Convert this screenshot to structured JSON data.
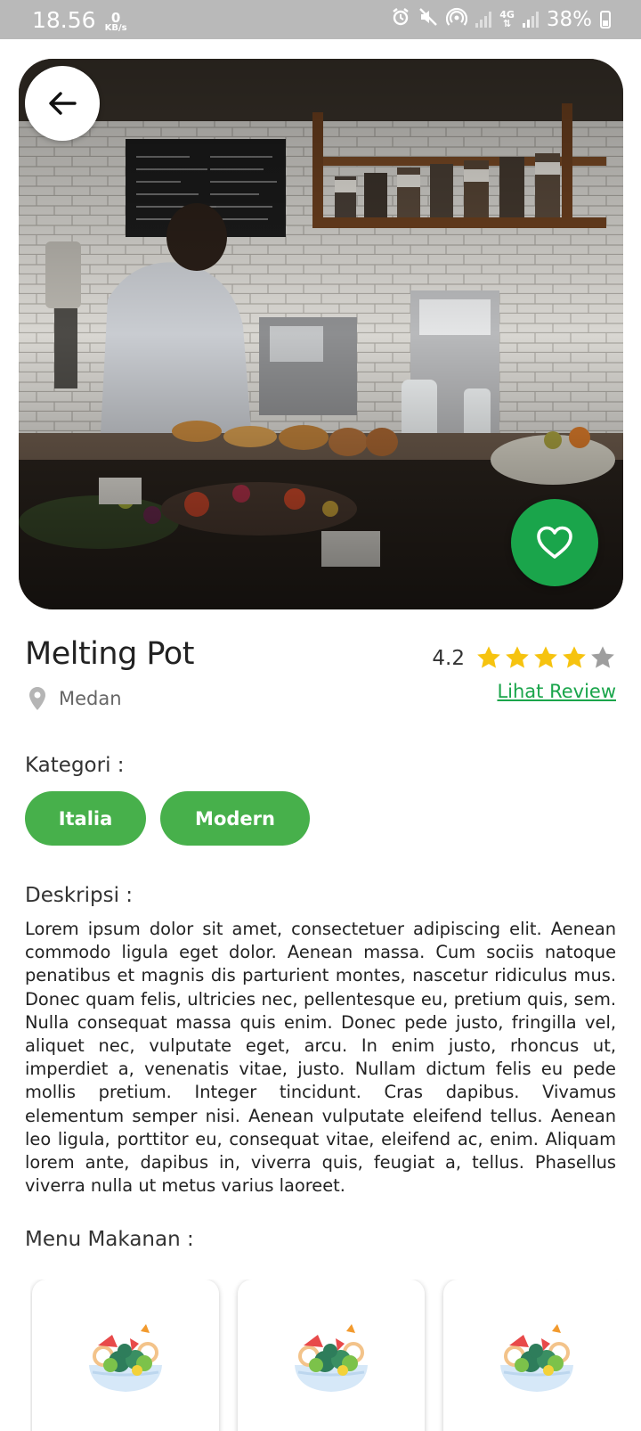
{
  "status_bar": {
    "time": "18.56",
    "net_speed_value": "0",
    "net_speed_unit": "KB/s",
    "network_type": "4G",
    "battery_percent": "38%",
    "icons": [
      "alarm-icon",
      "mute-icon",
      "hotspot-icon",
      "signal-icon",
      "4g-data-icon",
      "signal-icon",
      "battery-icon"
    ]
  },
  "hero": {
    "image_semantic": "photo",
    "back_icon": "arrow-left-icon",
    "favorite_icon": "heart-outline-icon",
    "accent": "#1aa54b"
  },
  "restaurant": {
    "name": "Melting Pot",
    "location": "Medan",
    "rating": 4.2,
    "rating_text": "4.2",
    "stars": {
      "filled": 4,
      "total": 5
    },
    "review_link": "Lihat Review"
  },
  "categories": {
    "label": "Kategori :",
    "items": [
      "Italia",
      "Modern"
    ],
    "chip_color": "#47b04b"
  },
  "description": {
    "label": "Deskripsi :",
    "text": "Lorem ipsum dolor sit amet, consectetuer adipiscing elit. Aenean commodo ligula eget dolor. Aenean massa. Cum sociis natoque penatibus et magnis dis parturient montes, nascetur ridiculus mus. Donec quam felis, ultricies nec, pellentesque eu, pretium quis, sem. Nulla consequat massa quis enim. Donec pede justo, fringilla vel, aliquet nec, vulputate eget, arcu. In enim justo, rhoncus ut, imperdiet a, venenatis vitae, justo. Nullam dictum felis eu pede mollis pretium. Integer tincidunt. Cras dapibus. Vivamus elementum semper nisi. Aenean vulputate eleifend tellus. Aenean leo ligula, porttitor eu, consequat vitae, eleifend ac, enim. Aliquam lorem ante, dapibus in, viverra quis, feugiat a, tellus. Phasellus viverra nulla ut metus varius laoreet."
  },
  "menu": {
    "label": "Menu Makanan :",
    "items": [
      {
        "icon": "salad-bowl-icon"
      },
      {
        "icon": "salad-bowl-icon"
      },
      {
        "icon": "salad-bowl-icon"
      }
    ]
  }
}
